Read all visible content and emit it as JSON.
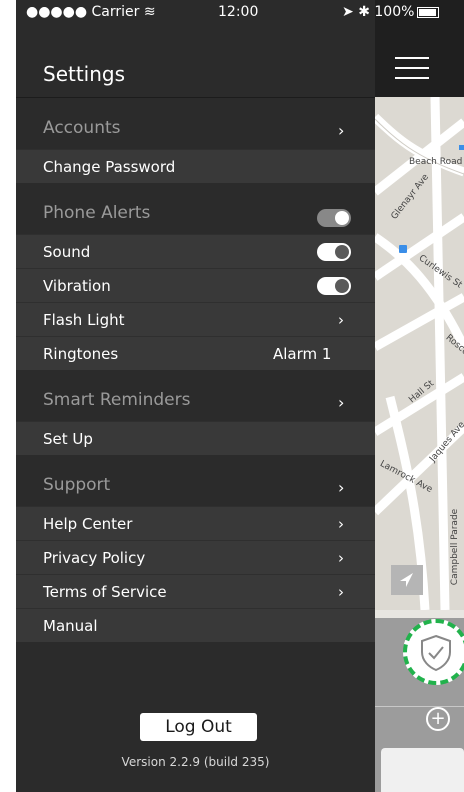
{
  "status_bar": {
    "carrier": "●●●●● Carrier",
    "time": "12:00",
    "battery": "100%"
  },
  "drawer": {
    "title": "Settings",
    "sections": [
      {
        "header": "Accounts",
        "rows": [
          "Change Password"
        ]
      },
      {
        "header": "Phone Alerts",
        "rows": [
          "Sound",
          "Vibration",
          "Flash Light",
          "Ringtones"
        ]
      },
      {
        "header": "Smart Reminders",
        "rows": [
          "Set Up"
        ]
      },
      {
        "header": "Support",
        "rows": [
          "Help Center",
          "Privacy Policy",
          "Terms of Service",
          "Manual"
        ]
      }
    ],
    "ringtone_value": "Alarm 1",
    "toggles": {
      "phone_alerts": true,
      "sound": true,
      "vibration": true
    },
    "logout_label": "Log Out",
    "version": "Version 2.2.9 (build 235)"
  },
  "map": {
    "labels": [
      "Beach Road",
      "Glenayr Ave",
      "Curlewis St",
      "Roscoe",
      "Hall St",
      "Jaques Ave",
      "Lamrock Ave",
      "Campbell Parade"
    ]
  },
  "colors": {
    "drawer_bg": "#2b2b2b",
    "row_bg": "#393939",
    "accent_green": "#22b24c"
  }
}
